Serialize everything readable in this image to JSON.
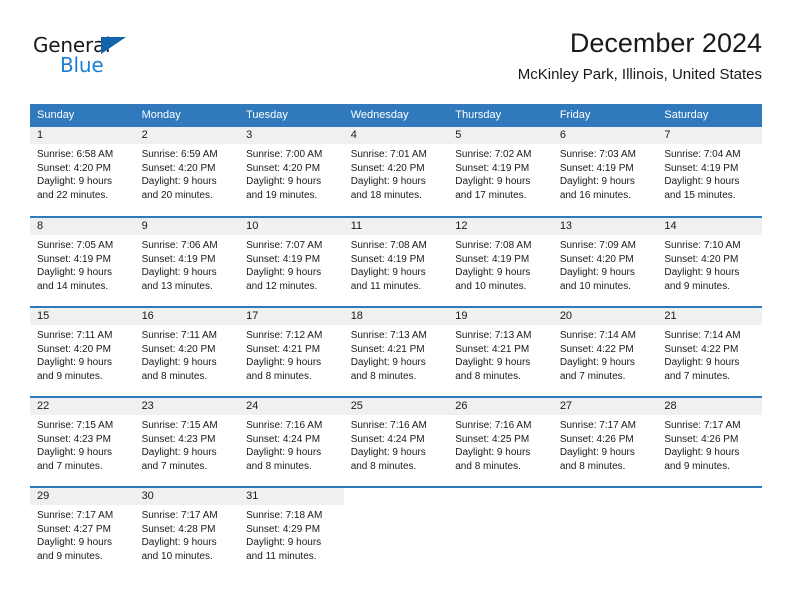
{
  "logo": {
    "word1": "General",
    "word2": "Blue",
    "triangle_color": "#1264ac",
    "blue_color": "#1b7fd4"
  },
  "header": {
    "title": "December 2024",
    "location": "McKinley Park, Illinois, United States"
  },
  "theme": {
    "header_bg": "#3079bd",
    "daynum_bg": "#f0f0f0",
    "text": "#1a1a1a"
  },
  "weekdays": [
    "Sunday",
    "Monday",
    "Tuesday",
    "Wednesday",
    "Thursday",
    "Friday",
    "Saturday"
  ],
  "weeks": [
    [
      {
        "day": "1",
        "sunrise": "Sunrise: 6:58 AM",
        "sunset": "Sunset: 4:20 PM",
        "daylight1": "Daylight: 9 hours",
        "daylight2": "and 22 minutes."
      },
      {
        "day": "2",
        "sunrise": "Sunrise: 6:59 AM",
        "sunset": "Sunset: 4:20 PM",
        "daylight1": "Daylight: 9 hours",
        "daylight2": "and 20 minutes."
      },
      {
        "day": "3",
        "sunrise": "Sunrise: 7:00 AM",
        "sunset": "Sunset: 4:20 PM",
        "daylight1": "Daylight: 9 hours",
        "daylight2": "and 19 minutes."
      },
      {
        "day": "4",
        "sunrise": "Sunrise: 7:01 AM",
        "sunset": "Sunset: 4:20 PM",
        "daylight1": "Daylight: 9 hours",
        "daylight2": "and 18 minutes."
      },
      {
        "day": "5",
        "sunrise": "Sunrise: 7:02 AM",
        "sunset": "Sunset: 4:19 PM",
        "daylight1": "Daylight: 9 hours",
        "daylight2": "and 17 minutes."
      },
      {
        "day": "6",
        "sunrise": "Sunrise: 7:03 AM",
        "sunset": "Sunset: 4:19 PM",
        "daylight1": "Daylight: 9 hours",
        "daylight2": "and 16 minutes."
      },
      {
        "day": "7",
        "sunrise": "Sunrise: 7:04 AM",
        "sunset": "Sunset: 4:19 PM",
        "daylight1": "Daylight: 9 hours",
        "daylight2": "and 15 minutes."
      }
    ],
    [
      {
        "day": "8",
        "sunrise": "Sunrise: 7:05 AM",
        "sunset": "Sunset: 4:19 PM",
        "daylight1": "Daylight: 9 hours",
        "daylight2": "and 14 minutes."
      },
      {
        "day": "9",
        "sunrise": "Sunrise: 7:06 AM",
        "sunset": "Sunset: 4:19 PM",
        "daylight1": "Daylight: 9 hours",
        "daylight2": "and 13 minutes."
      },
      {
        "day": "10",
        "sunrise": "Sunrise: 7:07 AM",
        "sunset": "Sunset: 4:19 PM",
        "daylight1": "Daylight: 9 hours",
        "daylight2": "and 12 minutes."
      },
      {
        "day": "11",
        "sunrise": "Sunrise: 7:08 AM",
        "sunset": "Sunset: 4:19 PM",
        "daylight1": "Daylight: 9 hours",
        "daylight2": "and 11 minutes."
      },
      {
        "day": "12",
        "sunrise": "Sunrise: 7:08 AM",
        "sunset": "Sunset: 4:19 PM",
        "daylight1": "Daylight: 9 hours",
        "daylight2": "and 10 minutes."
      },
      {
        "day": "13",
        "sunrise": "Sunrise: 7:09 AM",
        "sunset": "Sunset: 4:20 PM",
        "daylight1": "Daylight: 9 hours",
        "daylight2": "and 10 minutes."
      },
      {
        "day": "14",
        "sunrise": "Sunrise: 7:10 AM",
        "sunset": "Sunset: 4:20 PM",
        "daylight1": "Daylight: 9 hours",
        "daylight2": "and 9 minutes."
      }
    ],
    [
      {
        "day": "15",
        "sunrise": "Sunrise: 7:11 AM",
        "sunset": "Sunset: 4:20 PM",
        "daylight1": "Daylight: 9 hours",
        "daylight2": "and 9 minutes."
      },
      {
        "day": "16",
        "sunrise": "Sunrise: 7:11 AM",
        "sunset": "Sunset: 4:20 PM",
        "daylight1": "Daylight: 9 hours",
        "daylight2": "and 8 minutes."
      },
      {
        "day": "17",
        "sunrise": "Sunrise: 7:12 AM",
        "sunset": "Sunset: 4:21 PM",
        "daylight1": "Daylight: 9 hours",
        "daylight2": "and 8 minutes."
      },
      {
        "day": "18",
        "sunrise": "Sunrise: 7:13 AM",
        "sunset": "Sunset: 4:21 PM",
        "daylight1": "Daylight: 9 hours",
        "daylight2": "and 8 minutes."
      },
      {
        "day": "19",
        "sunrise": "Sunrise: 7:13 AM",
        "sunset": "Sunset: 4:21 PM",
        "daylight1": "Daylight: 9 hours",
        "daylight2": "and 8 minutes."
      },
      {
        "day": "20",
        "sunrise": "Sunrise: 7:14 AM",
        "sunset": "Sunset: 4:22 PM",
        "daylight1": "Daylight: 9 hours",
        "daylight2": "and 7 minutes."
      },
      {
        "day": "21",
        "sunrise": "Sunrise: 7:14 AM",
        "sunset": "Sunset: 4:22 PM",
        "daylight1": "Daylight: 9 hours",
        "daylight2": "and 7 minutes."
      }
    ],
    [
      {
        "day": "22",
        "sunrise": "Sunrise: 7:15 AM",
        "sunset": "Sunset: 4:23 PM",
        "daylight1": "Daylight: 9 hours",
        "daylight2": "and 7 minutes."
      },
      {
        "day": "23",
        "sunrise": "Sunrise: 7:15 AM",
        "sunset": "Sunset: 4:23 PM",
        "daylight1": "Daylight: 9 hours",
        "daylight2": "and 7 minutes."
      },
      {
        "day": "24",
        "sunrise": "Sunrise: 7:16 AM",
        "sunset": "Sunset: 4:24 PM",
        "daylight1": "Daylight: 9 hours",
        "daylight2": "and 8 minutes."
      },
      {
        "day": "25",
        "sunrise": "Sunrise: 7:16 AM",
        "sunset": "Sunset: 4:24 PM",
        "daylight1": "Daylight: 9 hours",
        "daylight2": "and 8 minutes."
      },
      {
        "day": "26",
        "sunrise": "Sunrise: 7:16 AM",
        "sunset": "Sunset: 4:25 PM",
        "daylight1": "Daylight: 9 hours",
        "daylight2": "and 8 minutes."
      },
      {
        "day": "27",
        "sunrise": "Sunrise: 7:17 AM",
        "sunset": "Sunset: 4:26 PM",
        "daylight1": "Daylight: 9 hours",
        "daylight2": "and 8 minutes."
      },
      {
        "day": "28",
        "sunrise": "Sunrise: 7:17 AM",
        "sunset": "Sunset: 4:26 PM",
        "daylight1": "Daylight: 9 hours",
        "daylight2": "and 9 minutes."
      }
    ],
    [
      {
        "day": "29",
        "sunrise": "Sunrise: 7:17 AM",
        "sunset": "Sunset: 4:27 PM",
        "daylight1": "Daylight: 9 hours",
        "daylight2": "and 9 minutes."
      },
      {
        "day": "30",
        "sunrise": "Sunrise: 7:17 AM",
        "sunset": "Sunset: 4:28 PM",
        "daylight1": "Daylight: 9 hours",
        "daylight2": "and 10 minutes."
      },
      {
        "day": "31",
        "sunrise": "Sunrise: 7:18 AM",
        "sunset": "Sunset: 4:29 PM",
        "daylight1": "Daylight: 9 hours",
        "daylight2": "and 11 minutes."
      },
      {
        "day": "",
        "sunrise": "",
        "sunset": "",
        "daylight1": "",
        "daylight2": ""
      },
      {
        "day": "",
        "sunrise": "",
        "sunset": "",
        "daylight1": "",
        "daylight2": ""
      },
      {
        "day": "",
        "sunrise": "",
        "sunset": "",
        "daylight1": "",
        "daylight2": ""
      },
      {
        "day": "",
        "sunrise": "",
        "sunset": "",
        "daylight1": "",
        "daylight2": ""
      }
    ]
  ]
}
